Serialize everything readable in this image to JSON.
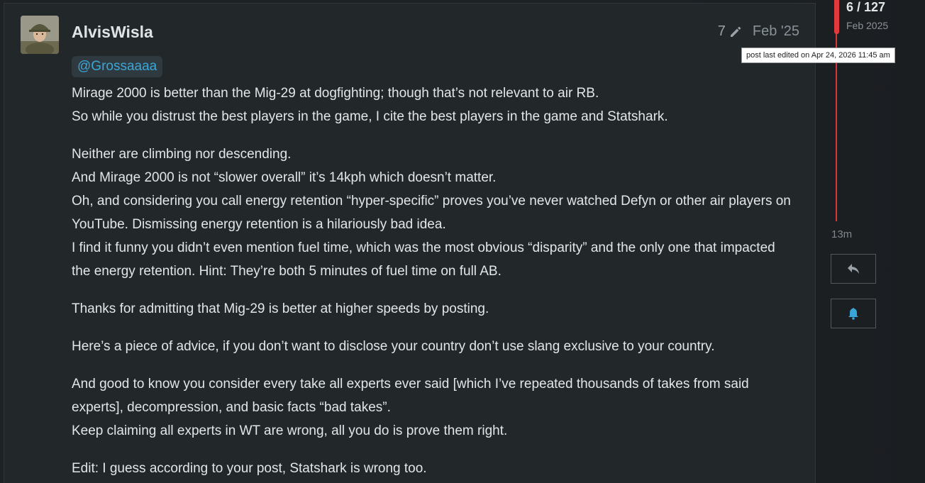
{
  "post": {
    "username": "AlvisWisla",
    "edit_count": "7",
    "date": "Feb '25",
    "mention": "@Grossaaaa",
    "paragraphs": [
      [
        "Mirage 2000 is better than the Mig-29 at dogfighting; though that’s not relevant to air RB.",
        "So while you distrust the best players in the game, I cite the best players in the game and Statshark."
      ],
      [
        "Neither are climbing nor descending.",
        "And Mirage 2000 is not “slower overall” it’s 14kph which doesn’t matter.",
        "Oh, and considering you call energy retention “hyper-specific” proves you’ve never watched Defyn or other air players on YouTube. Dismissing energy retention is a hilariously bad idea.",
        "I find it funny you didn’t even mention fuel time, which was the most obvious “disparity” and the only one that impacted the energy retention. Hint: They’re both 5 minutes of fuel time on full AB."
      ],
      [
        "Thanks for admitting that Mig-29 is better at higher speeds by posting."
      ],
      [
        "Here’s a piece of advice, if you don’t want to disclose your country don’t use slang exclusive to your country."
      ],
      [
        "And good to know you consider every take all experts ever said [which I’ve repeated thousands of takes from said experts], decompression, and basic facts “bad takes”.",
        "Keep claiming all experts in WT are wrong, all you do is prove them right."
      ],
      [
        "Edit: I guess according to your post, Statshark is wrong too."
      ]
    ]
  },
  "timeline": {
    "position": "6 / 127",
    "date": "Feb 2025",
    "end_label": "13m",
    "tooltip": "post last edited on Apr 24, 2026 11:45 am"
  },
  "icons": {
    "edit": "pencil-icon",
    "reply": "reply-icon",
    "notify": "bell-icon"
  },
  "colors": {
    "accent": "#3aa6d8",
    "timeline": "#e0393e",
    "background": "#22272a"
  }
}
